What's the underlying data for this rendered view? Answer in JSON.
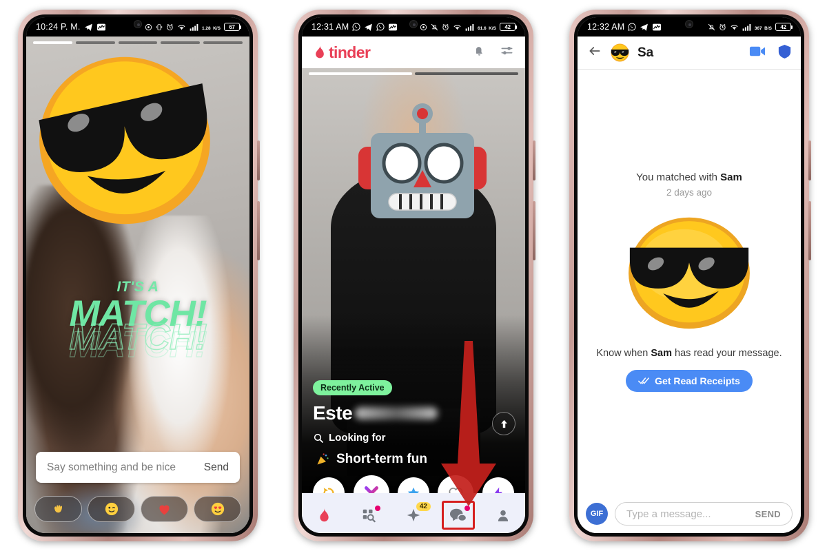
{
  "phones": [
    {
      "id": "match-screen",
      "statusbar": {
        "time": "10:24 P. M.",
        "left_icons": [
          "telegram-icon",
          "chart-icon"
        ],
        "right_icons": [
          "location-icon",
          "vibrate-icon",
          "alarm-icon",
          "wifi-icon",
          "signal-icon"
        ],
        "data_rate": "1.28",
        "data_unit": "K/S",
        "battery": "67"
      },
      "story_segments": 5,
      "story_active_index": 0,
      "overlay_emoji": "sunglasses-face-emoji",
      "match": {
        "its_a": "IT'S A",
        "match": "MATCH!"
      },
      "compose": {
        "placeholder": "Say something and be nice",
        "send_label": "Send"
      },
      "reactions": [
        {
          "name": "waving-hand-emoji"
        },
        {
          "name": "winking-face-emoji"
        },
        {
          "name": "red-heart-emoji"
        },
        {
          "name": "heart-eyes-emoji"
        }
      ]
    },
    {
      "id": "tinder-card-screen",
      "statusbar": {
        "time": "12:31 AM",
        "left_icons": [
          "whatsapp-icon",
          "telegram-icon",
          "whatsapp-icon",
          "chart-icon"
        ],
        "right_icons": [
          "location-icon",
          "bell-off-icon",
          "alarm-icon",
          "wifi-icon",
          "signal-icon"
        ],
        "data_rate": "61.6",
        "data_unit": "K/S",
        "battery": "42"
      },
      "header": {
        "brand": "tinder",
        "icons": [
          "bell-icon",
          "sliders-icon"
        ]
      },
      "card": {
        "story_segments": 2,
        "story_active_index": 0,
        "overlay_emoji": "robot-face-emoji",
        "badge": "Recently Active",
        "name": "Este",
        "looking_label": "Looking for",
        "goal": "Short-term fun",
        "goal_emoji": "party-popper-emoji",
        "up_icon": "arrow-up-icon"
      },
      "actions": [
        {
          "name": "rewind-button",
          "icon": "rewind-icon"
        },
        {
          "name": "nope-button",
          "icon": "x-icon"
        },
        {
          "name": "superlike-button",
          "icon": "star-icon"
        },
        {
          "name": "like-button",
          "icon": "heart-icon"
        },
        {
          "name": "boost-button",
          "icon": "lightning-icon"
        }
      ],
      "nav": [
        {
          "name": "nav-flame",
          "icon": "flame-icon",
          "dot": false,
          "badge": ""
        },
        {
          "name": "nav-explore",
          "icon": "explore-icon",
          "dot": true,
          "badge": ""
        },
        {
          "name": "nav-likes",
          "icon": "sparkle-icon",
          "dot": false,
          "badge": "42"
        },
        {
          "name": "nav-messages",
          "icon": "chat-bubbles-icon",
          "dot": true,
          "badge": "",
          "highlighted": true
        },
        {
          "name": "nav-profile",
          "icon": "person-icon",
          "dot": false,
          "badge": ""
        }
      ],
      "annotation": {
        "name": "red-down-arrow",
        "points_to": "nav-messages"
      }
    },
    {
      "id": "chat-screen",
      "statusbar": {
        "time": "12:32 AM",
        "left_icons": [
          "whatsapp-icon",
          "telegram-icon",
          "chart-icon"
        ],
        "right_icons": [
          "bell-off-icon",
          "alarm-icon",
          "wifi-icon",
          "signal-icon"
        ],
        "data_rate": "367",
        "data_unit": "B/S",
        "battery": "42"
      },
      "header": {
        "back_icon": "arrow-left-icon",
        "avatar": "sunglasses-face-emoji",
        "title": "Sa",
        "right_icons": [
          "video-camera-icon",
          "shield-icon"
        ]
      },
      "body": {
        "matched_prefix": "You matched with ",
        "matched_name": "Sam",
        "matched_time": "2 days ago",
        "big_emoji": "sunglasses-face-emoji",
        "know_prefix": "Know when ",
        "know_name": "Sam",
        "know_suffix": " has read your message.",
        "read_receipts_button": "Get Read Receipts",
        "read_receipts_icon": "double-check-icon"
      },
      "input": {
        "gif_label": "GIF",
        "placeholder": "Type a message...",
        "send_label": "SEND"
      }
    }
  ],
  "colors": {
    "tinder_red": "#e94057",
    "match_green": "#6fe6a4",
    "recently_active": "#7ef29d",
    "annotation_red": "#d61f1f",
    "blue_accent": "#4a8bf5",
    "gif_blue": "#3d6fd4",
    "badge_yellow": "#ffd84d",
    "nav_dot_pink": "#e6006e"
  }
}
